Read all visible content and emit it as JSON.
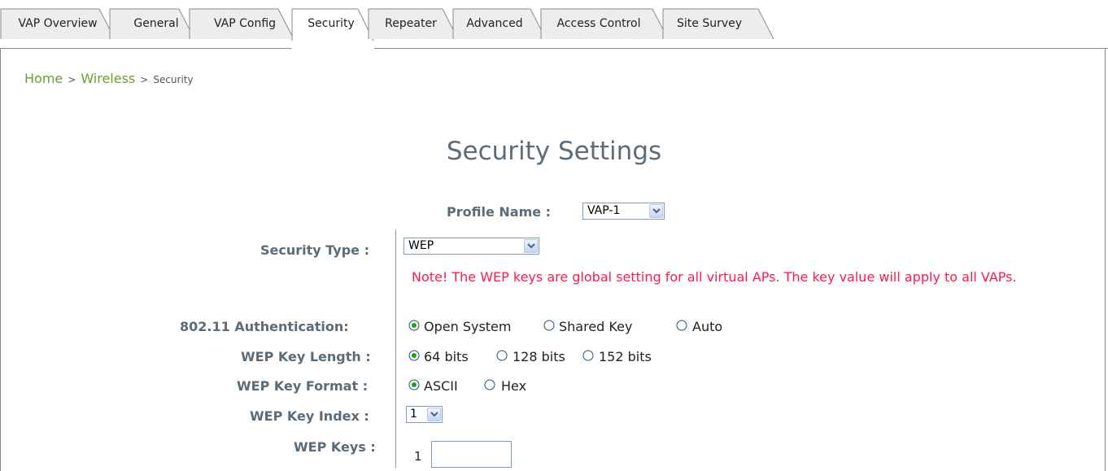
{
  "tabs": [
    {
      "label": "VAP Overview",
      "active": false
    },
    {
      "label": "General",
      "active": false
    },
    {
      "label": "VAP Config",
      "active": false
    },
    {
      "label": "Security",
      "active": true
    },
    {
      "label": "Repeater",
      "active": false
    },
    {
      "label": "Advanced",
      "active": false
    },
    {
      "label": "Access Control",
      "active": false
    },
    {
      "label": "Site Survey",
      "active": false
    }
  ],
  "breadcrumb": {
    "home": "Home",
    "wireless": "Wireless",
    "current": "Security",
    "separator": ">"
  },
  "page_title": "Security Settings",
  "profile": {
    "label": "Profile Name :",
    "value": "VAP-1"
  },
  "security_type": {
    "label": "Security Type :",
    "value": "WEP"
  },
  "note": "Note! The WEP keys are global setting for all virtual APs. The key value will apply to all VAPs.",
  "authentication": {
    "label": "802.11 Authentication:",
    "options": [
      "Open System",
      "Shared Key",
      "Auto"
    ],
    "selected": "Open System"
  },
  "key_length": {
    "label": "WEP Key Length :",
    "options": [
      "64 bits",
      "128 bits",
      "152 bits"
    ],
    "selected": "64 bits"
  },
  "key_format": {
    "label": "WEP Key Format :",
    "options": [
      "ASCII",
      "Hex"
    ],
    "selected": "ASCII"
  },
  "key_index": {
    "label": "WEP Key Index :",
    "value": "1"
  },
  "wep_keys": {
    "label": "WEP Keys :",
    "index": "1",
    "value": ""
  },
  "colors": {
    "accent_green": "#6a9e2e",
    "label_slate": "#5b6b77",
    "note_red": "#ff1a4a",
    "tab_active_bg": "#ffffff",
    "tab_inactive_bg": "#ededed"
  }
}
